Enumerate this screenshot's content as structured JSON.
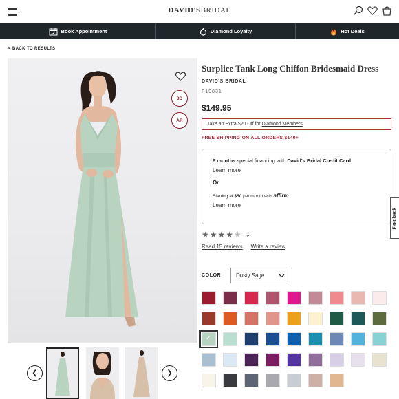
{
  "header": {
    "logo_bold": "DAVID'S",
    "logo_light": "BRIDAL",
    "icons": [
      "menu-icon",
      "search-icon",
      "heart-icon",
      "bag-icon"
    ]
  },
  "nav": {
    "items": [
      {
        "label": "Book Appointment",
        "icon": "calendar-icon"
      },
      {
        "label": "Diamond Loyalty",
        "icon": "ring-icon"
      },
      {
        "label": "Hot Deals",
        "icon": "flame-icon"
      }
    ]
  },
  "back_link": "< BACK TO RESULTS",
  "image": {
    "btn_3d": "3D",
    "btn_ar": "AR",
    "dress_color": "#b8d4c0"
  },
  "product": {
    "title": "Surplice Tank Long Chiffon Bridesmaid Dress",
    "brand": "DAVID'S BRIDAL",
    "sku": "F19831",
    "price": "$149.95",
    "promo_text": "Take an Extra $20 Off for ",
    "promo_link": "Diamond Members",
    "shipping": "FREE SHIPPING ON ALL ORDERS $149+"
  },
  "financing": {
    "months": "6 months",
    "text": " special financing with ",
    "card": "David's Bridal Credit Card",
    "learn_more_1": "Learn more",
    "or": "Or",
    "starting_prefix": "Starting at ",
    "starting_amount": "$50",
    "starting_suffix": " per month with ",
    "affirm": "affirm",
    "learn_more_2": "Learn more"
  },
  "rating": {
    "value": 4,
    "max": 5,
    "read_reviews": "Read 15 reviews",
    "write_review": "Write a review"
  },
  "color": {
    "label": "COLOR",
    "selected": "Dusty Sage",
    "swatches": [
      "#9c1b2e",
      "#7a2e4a",
      "#d6294e",
      "#b05470",
      "#e0178f",
      "#c28a97",
      "#ef8a8f",
      "#e9b8ae",
      "#fbecea",
      "#9a3a2c",
      "#dd5a22",
      "#d47368",
      "#e2958a",
      "#eda11a",
      "#fcf2cf",
      "#1f5b45",
      "#1c5a5a",
      "#5e6b3d",
      "#b7d3c1",
      "#b9dfd1",
      "#1f3f6e",
      "#1a4f93",
      "#1060b0",
      "#1a8fb0",
      "#6d88b4",
      "#52b2db",
      "#88d2d6",
      "#a9bfd2",
      "#dde8f5",
      "#4d2458",
      "#7d1e62",
      "#5536a0",
      "#916e9c",
      "#d7cfe5",
      "#e7e1ee",
      "#e8e3cf",
      "#f8f4ea",
      "#3a3b3f",
      "#5e6572",
      "#a9a9ad",
      "#c7cdd3",
      "#cdb0a8",
      "#e1b792"
    ],
    "selected_index": 18
  },
  "feedback": "Feedback"
}
